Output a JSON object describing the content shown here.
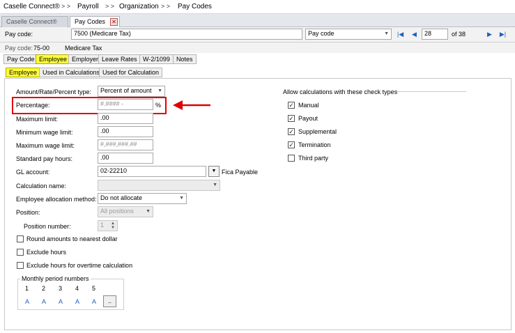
{
  "breadcrumb": [
    "Caselle Connect®",
    "Payroll",
    "Organization",
    "Pay Codes"
  ],
  "breadcrumb_separator": "> >",
  "doc_tabs": [
    {
      "label": "Caselle Connect®"
    },
    {
      "label": "Pay Codes"
    }
  ],
  "paycode": {
    "label": "Pay code:",
    "value": "7500 (Medicare Tax)",
    "search_by": "Pay code",
    "record": "28",
    "record_total": "of 38"
  },
  "info": {
    "label": "Pay code:",
    "code": "75-00",
    "name": "Medicare Tax"
  },
  "main_tabs": [
    "Pay Code",
    "Employee",
    "Employer",
    "Leave Rates",
    "W-2/1099",
    "Notes"
  ],
  "sub_tabs": [
    "Employee",
    "Used in Calculations",
    "Used for Calculation"
  ],
  "form": {
    "amount_type_label": "Amount/Rate/Percent type:",
    "amount_type_value": "Percent of amount",
    "percentage_label": "Percentage:",
    "percentage_value": "#.#### -",
    "percent_unit": "%",
    "max_limit_label": "Maximum limit:",
    "max_limit_value": ".00",
    "min_wage_label": "Minimum wage limit:",
    "min_wage_value": ".00",
    "max_wage_label": "Maximum wage limit:",
    "max_wage_value": "#,###,###.##",
    "std_hours_label": "Standard pay hours:",
    "std_hours_value": ".00",
    "gl_label": "GL account:",
    "gl_value": "02-22210",
    "gl_desc": "Fica Payable",
    "calc_name_label": "Calculation name:",
    "calc_name_value": "",
    "alloc_label": "Employee allocation method:",
    "alloc_value": "Do not allocate",
    "position_label": "Position:",
    "position_value": "All positions",
    "position_number_label": "Position number:",
    "position_number_value": "1",
    "round_label": "Round amounts to nearest dollar",
    "exclude_hours_label": "Exclude hours",
    "exclude_ot_label": "Exclude hours for overtime calculation",
    "monthly_label": "Monthly period numbers",
    "monthly_numbers": [
      "1",
      "2",
      "3",
      "4",
      "5"
    ],
    "monthly_values": [
      "A",
      "A",
      "A",
      "A",
      "A"
    ],
    "more_label": ".."
  },
  "check_types": {
    "title": "Allow calculations with these check types",
    "items": [
      {
        "label": "Manual",
        "checked": true
      },
      {
        "label": "Payout",
        "checked": true
      },
      {
        "label": "Supplemental",
        "checked": true
      },
      {
        "label": "Termination",
        "checked": true
      },
      {
        "label": "Third party",
        "checked": false
      }
    ]
  },
  "colors": {
    "highlight": "#ffff3c",
    "callout": "#e00000",
    "nav_blue": "#1f5fbf"
  }
}
